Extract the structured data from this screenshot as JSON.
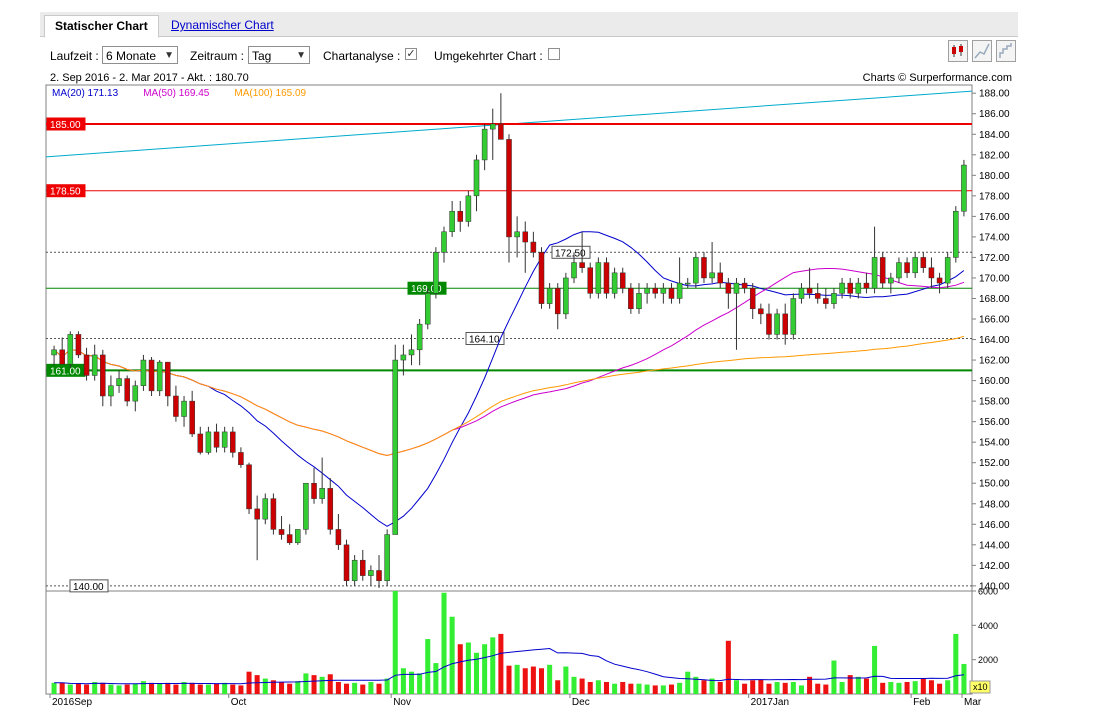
{
  "tabs": {
    "active": "Statischer Chart",
    "other": "Dynamischer Chart"
  },
  "controls": {
    "laufzeit_label": "Laufzeit :",
    "laufzeit_value": "6 Monate",
    "zeitraum_label": "Zeitraum :",
    "zeitraum_value": "Tag",
    "chartanalyse_label": "Chartanalyse :",
    "umgekehrt_label": "Umgekehrter Chart :",
    "chartanalyse_checked": true,
    "umgekehrt_checked": false
  },
  "info_line": "2. Sep 2016 - 2. Mar 2017 - Akt. : 180.70",
  "credit": "Charts © Surperformance.com",
  "colors": {
    "up": "#33cc33",
    "down": "#cc0000",
    "ma20": "#0000cc",
    "ma50": "#cc00cc",
    "ma100": "#ff9900",
    "trend": "#00aacc",
    "green_line": "#008800",
    "red_line": "#ee0000"
  },
  "chart_data": {
    "type": "candlestick",
    "ylim": [
      139.5,
      188.8
    ],
    "yticks": [
      "140.00",
      "142.00",
      "144.00",
      "146.00",
      "148.00",
      "150.00",
      "152.00",
      "154.00",
      "156.00",
      "158.00",
      "160.00",
      "162.00",
      "164.00",
      "166.00",
      "168.00",
      "170.00",
      "172.00",
      "174.00",
      "176.00",
      "178.00",
      "180.00",
      "182.00",
      "184.00",
      "186.00",
      "188.00"
    ],
    "xticks": [
      "2016Sep",
      "Oct",
      "Nov",
      "Dec",
      "2017Jan",
      "Feb",
      "Mar"
    ],
    "legend": [
      {
        "name": "MA(20)",
        "value": "171.13",
        "color": "#0000cc"
      },
      {
        "name": "MA(50)",
        "value": "169.45",
        "color": "#cc00cc"
      },
      {
        "name": "MA(100)",
        "value": "165.09",
        "color": "#ff9900"
      }
    ],
    "levels": [
      {
        "label": "185.00",
        "value": 185.0,
        "kind": "red-solid"
      },
      {
        "label": "178.50",
        "value": 178.5,
        "kind": "red-solid"
      },
      {
        "label": "172.50",
        "value": 172.5,
        "kind": "dashed"
      },
      {
        "label": "169.00",
        "value": 169.0,
        "kind": "green-solid"
      },
      {
        "label": "164.10",
        "value": 164.1,
        "kind": "dashed"
      },
      {
        "label": "161.00",
        "value": 161.0,
        "kind": "green-solid"
      },
      {
        "label": "140.00",
        "value": 140.0,
        "kind": "dashed"
      }
    ],
    "trendline": {
      "from": 181.8,
      "to": 188.2
    },
    "candles": [
      [
        162.5,
        163.4,
        161.5,
        163.0
      ],
      [
        163.0,
        164.2,
        161.8,
        161.6
      ],
      [
        161.6,
        164.8,
        161.2,
        164.5
      ],
      [
        164.5,
        164.8,
        162.2,
        162.5
      ],
      [
        162.5,
        163.2,
        160.0,
        160.5
      ],
      [
        160.5,
        163.5,
        160.0,
        162.5
      ],
      [
        162.5,
        163.0,
        157.5,
        158.5
      ],
      [
        158.5,
        160.5,
        157.5,
        159.5
      ],
      [
        159.5,
        161.0,
        158.8,
        160.2
      ],
      [
        160.2,
        160.5,
        157.5,
        158.0
      ],
      [
        158.0,
        160.0,
        157.0,
        159.5
      ],
      [
        159.5,
        162.5,
        159.0,
        162.0
      ],
      [
        162.0,
        162.3,
        158.5,
        159.0
      ],
      [
        159.0,
        162.0,
        158.5,
        161.8
      ],
      [
        161.8,
        161.8,
        157.5,
        158.5
      ],
      [
        158.5,
        159.5,
        156.0,
        156.5
      ],
      [
        156.5,
        158.5,
        155.5,
        158.0
      ],
      [
        158.0,
        159.0,
        154.5,
        154.8
      ],
      [
        154.8,
        155.5,
        152.8,
        153.0
      ],
      [
        153.0,
        155.5,
        152.8,
        155.0
      ],
      [
        155.0,
        155.8,
        153.0,
        153.5
      ],
      [
        153.5,
        155.5,
        153.0,
        155.0
      ],
      [
        155.0,
        155.5,
        152.5,
        153.0
      ],
      [
        153.0,
        153.5,
        151.5,
        151.8
      ],
      [
        151.8,
        152.0,
        147.0,
        147.5
      ],
      [
        147.5,
        148.8,
        142.5,
        146.5
      ],
      [
        146.5,
        149.0,
        146.0,
        148.5
      ],
      [
        148.5,
        149.0,
        145.0,
        145.5
      ],
      [
        145.5,
        146.8,
        144.5,
        145.0
      ],
      [
        145.0,
        146.0,
        144.0,
        144.2
      ],
      [
        144.2,
        145.5,
        144.0,
        145.5
      ],
      [
        145.5,
        150.0,
        145.0,
        150.0
      ],
      [
        150.0,
        151.5,
        148.0,
        148.5
      ],
      [
        148.5,
        152.5,
        148.0,
        149.5
      ],
      [
        149.5,
        150.5,
        145.0,
        145.5
      ],
      [
        145.5,
        147.0,
        143.5,
        144.0
      ],
      [
        144.0,
        144.5,
        140.0,
        140.5
      ],
      [
        140.5,
        143.0,
        140.0,
        142.5
      ],
      [
        142.5,
        143.5,
        140.5,
        141.0
      ],
      [
        141.0,
        142.0,
        140.0,
        141.5
      ],
      [
        141.5,
        143.0,
        139.8,
        140.5
      ],
      [
        140.5,
        145.5,
        140.0,
        145.0
      ],
      [
        145.0,
        163.5,
        157.5,
        162.0
      ],
      [
        162.0,
        163.5,
        160.5,
        162.5
      ],
      [
        162.5,
        164.5,
        161.5,
        163.0
      ],
      [
        163.0,
        166.0,
        161.5,
        165.5
      ],
      [
        165.5,
        169.0,
        165.0,
        168.5
      ],
      [
        168.5,
        173.0,
        168.0,
        172.5
      ],
      [
        172.5,
        175.0,
        171.5,
        174.5
      ],
      [
        174.5,
        177.5,
        174.0,
        176.5
      ],
      [
        176.5,
        177.5,
        174.5,
        175.5
      ],
      [
        175.5,
        178.5,
        175.0,
        178.0
      ],
      [
        178.0,
        182.0,
        176.5,
        181.5
      ],
      [
        181.5,
        185.0,
        180.5,
        184.5
      ],
      [
        184.5,
        186.5,
        181.5,
        185.0
      ],
      [
        185.0,
        188.0,
        183.5,
        183.5
      ],
      [
        183.5,
        184.0,
        171.5,
        174.0
      ],
      [
        174.0,
        176.0,
        172.0,
        174.5
      ],
      [
        174.5,
        175.5,
        170.5,
        173.5
      ],
      [
        173.5,
        174.5,
        172.0,
        172.5
      ],
      [
        172.5,
        173.0,
        167.0,
        167.5
      ],
      [
        167.5,
        169.5,
        167.0,
        169.0
      ],
      [
        169.0,
        169.5,
        165.0,
        166.5
      ],
      [
        166.5,
        170.5,
        166.0,
        170.0
      ],
      [
        170.0,
        172.5,
        169.5,
        171.5
      ],
      [
        171.5,
        174.5,
        170.5,
        171.0
      ],
      [
        171.0,
        171.5,
        168.0,
        168.5
      ],
      [
        168.5,
        172.0,
        168.0,
        171.5
      ],
      [
        171.5,
        172.0,
        168.0,
        168.5
      ],
      [
        168.5,
        171.0,
        168.0,
        170.5
      ],
      [
        170.5,
        171.0,
        168.5,
        169.0
      ],
      [
        169.0,
        169.5,
        166.5,
        167.0
      ],
      [
        167.0,
        169.5,
        166.5,
        168.5
      ],
      [
        168.5,
        169.5,
        167.5,
        169.0
      ],
      [
        169.0,
        169.5,
        168.0,
        168.5
      ],
      [
        168.5,
        169.5,
        167.5,
        169.0
      ],
      [
        169.0,
        169.5,
        167.5,
        168.0
      ],
      [
        168.0,
        172.0,
        167.5,
        169.5
      ],
      [
        169.5,
        170.0,
        169.0,
        169.5
      ],
      [
        169.5,
        172.5,
        169.0,
        172.0
      ],
      [
        172.0,
        172.5,
        169.5,
        170.0
      ],
      [
        170.0,
        173.5,
        169.5,
        170.5
      ],
      [
        170.5,
        171.5,
        169.0,
        169.5
      ],
      [
        169.5,
        170.0,
        167.0,
        168.5
      ],
      [
        168.5,
        170.0,
        163.0,
        169.5
      ],
      [
        169.5,
        170.0,
        168.5,
        169.0
      ],
      [
        169.0,
        169.5,
        166.0,
        167.0
      ],
      [
        167.0,
        167.5,
        165.5,
        166.5
      ],
      [
        166.5,
        167.5,
        164.0,
        164.5
      ],
      [
        164.5,
        167.0,
        164.0,
        166.5
      ],
      [
        166.5,
        167.5,
        163.5,
        164.5
      ],
      [
        164.5,
        168.5,
        164.0,
        168.0
      ],
      [
        168.0,
        169.5,
        167.5,
        169.0
      ],
      [
        169.0,
        171.0,
        168.0,
        168.5
      ],
      [
        168.5,
        169.5,
        167.5,
        168.0
      ],
      [
        168.0,
        169.0,
        167.0,
        167.5
      ],
      [
        167.5,
        169.0,
        167.0,
        168.5
      ],
      [
        168.5,
        170.0,
        168.0,
        169.5
      ],
      [
        169.5,
        170.0,
        168.0,
        168.5
      ],
      [
        168.5,
        170.0,
        168.0,
        169.5
      ],
      [
        169.5,
        170.5,
        168.5,
        169.0
      ],
      [
        169.0,
        175.0,
        168.5,
        172.0
      ],
      [
        172.0,
        172.5,
        169.0,
        169.5
      ],
      [
        169.5,
        170.5,
        168.5,
        170.0
      ],
      [
        170.0,
        172.0,
        169.5,
        171.5
      ],
      [
        171.5,
        172.0,
        170.0,
        170.5
      ],
      [
        170.5,
        172.5,
        170.0,
        172.0
      ],
      [
        172.0,
        172.5,
        170.5,
        171.0
      ],
      [
        171.0,
        172.0,
        169.0,
        170.0
      ],
      [
        170.0,
        170.5,
        168.5,
        169.5
      ],
      [
        169.5,
        172.5,
        169.0,
        172.0
      ],
      [
        172.0,
        177.0,
        171.5,
        176.5
      ],
      [
        176.5,
        181.5,
        176.0,
        181.0
      ]
    ],
    "volume_axis": {
      "ymax": 6000,
      "ticks": [
        "6000",
        "4000",
        "2000"
      ],
      "unit": "x10"
    },
    "volumes": [
      650,
      650,
      550,
      600,
      550,
      700,
      650,
      550,
      500,
      550,
      600,
      750,
      650,
      600,
      650,
      550,
      700,
      650,
      550,
      550,
      600,
      650,
      550,
      500,
      1300,
      1100,
      900,
      800,
      700,
      600,
      750,
      1200,
      1100,
      1000,
      1150,
      700,
      600,
      650,
      550,
      700,
      600,
      900,
      6000,
      1500,
      1300,
      1200,
      3200,
      1800,
      5900,
      4500,
      2900,
      3000,
      2400,
      2900,
      3300,
      3500,
      1650,
      1700,
      1500,
      1600,
      1500,
      1700,
      800,
      1600,
      1000,
      900,
      700,
      800,
      700,
      600,
      700,
      600,
      600,
      550,
      500,
      500,
      550,
      650,
      1300,
      1000,
      800,
      900,
      700,
      3100,
      800,
      600,
      800,
      850,
      600,
      700,
      650,
      700,
      500,
      1000,
      600,
      550,
      1950,
      700,
      1100,
      1000,
      900,
      2800,
      650,
      700,
      650,
      700,
      750,
      900,
      800,
      600,
      800,
      3500,
      1750
    ]
  }
}
